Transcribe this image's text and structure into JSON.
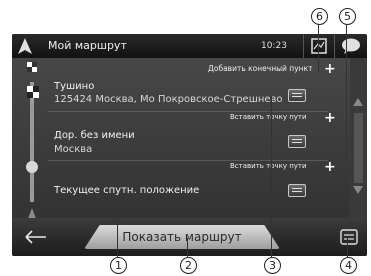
{
  "header": {
    "title": "Мой маршрут",
    "time": "10:23"
  },
  "route": {
    "add_end_label": "Добавить конечный пункт",
    "insert_label": "Вставить точку пути",
    "stops": [
      {
        "line1": "Тушино",
        "line2": "125424 Москва, Мо Покровское-Стрешнево"
      },
      {
        "line1": "Дор. без имени",
        "line2": "Москва"
      },
      {
        "line1": "Текущее спутн. положение",
        "line2": ""
      }
    ]
  },
  "footer": {
    "show_route_label": "Показать маршрут"
  },
  "callouts": [
    "1",
    "2",
    "3",
    "4",
    "5",
    "6"
  ],
  "icons": [
    "navigation-arrow-icon",
    "map-icon",
    "message-icon",
    "flag-icon",
    "position-icon",
    "vehicle-icon",
    "back-arrow-icon",
    "menu-icon",
    "plus-icon"
  ]
}
